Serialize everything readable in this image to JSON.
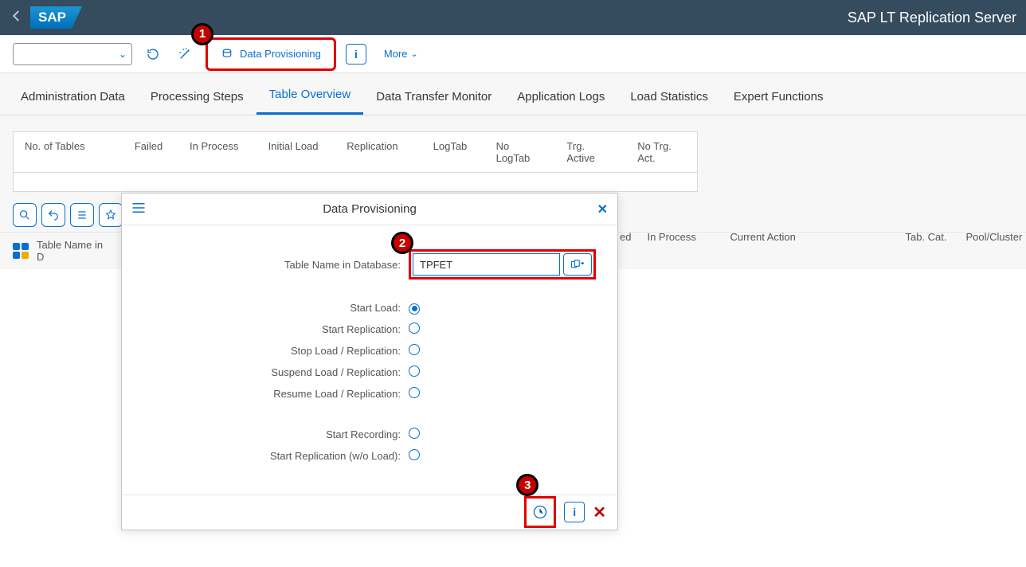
{
  "header": {
    "app_title": "SAP LT Replication Server",
    "logo_text": "SAP"
  },
  "toolbar": {
    "data_provisioning_label": "Data Provisioning",
    "more_label": "More",
    "info_glyph": "i"
  },
  "tabs": [
    {
      "label": "Administration Data"
    },
    {
      "label": "Processing Steps"
    },
    {
      "label": "Table Overview",
      "active": true
    },
    {
      "label": "Data Transfer Monitor"
    },
    {
      "label": "Application Logs"
    },
    {
      "label": "Load Statistics"
    },
    {
      "label": "Expert Functions"
    }
  ],
  "stats_headers": {
    "no_of_tables": "No. of Tables",
    "failed": "Failed",
    "in_process": "In Process",
    "initial_load": "Initial Load",
    "replication": "Replication",
    "logtab": "LogTab",
    "no_logtab": "No LogTab",
    "trg_active": "Trg. Active",
    "no_trg_act": "No Trg. Act."
  },
  "grid_columns": {
    "table_name": "Table Name in D",
    "ed": "ed",
    "in_process": "In Process",
    "current_action": "Current Action",
    "tab_cat": "Tab. Cat.",
    "pool_cluster": "Pool/Cluster"
  },
  "dialog": {
    "title": "Data Provisioning",
    "field_label": "Table Name in Database:",
    "field_value": "TPFET",
    "options": {
      "start_load": "Start Load:",
      "start_replication": "Start Replication:",
      "stop_load_replication": "Stop Load / Replication:",
      "suspend_load_replication": "Suspend Load / Replication:",
      "resume_load_replication": "Resume Load / Replication:",
      "start_recording": "Start Recording:",
      "start_replication_wo_load": "Start Replication (w/o Load):"
    },
    "selected_option": "start_load"
  },
  "callouts": {
    "1": "1",
    "2": "2",
    "3": "3"
  }
}
